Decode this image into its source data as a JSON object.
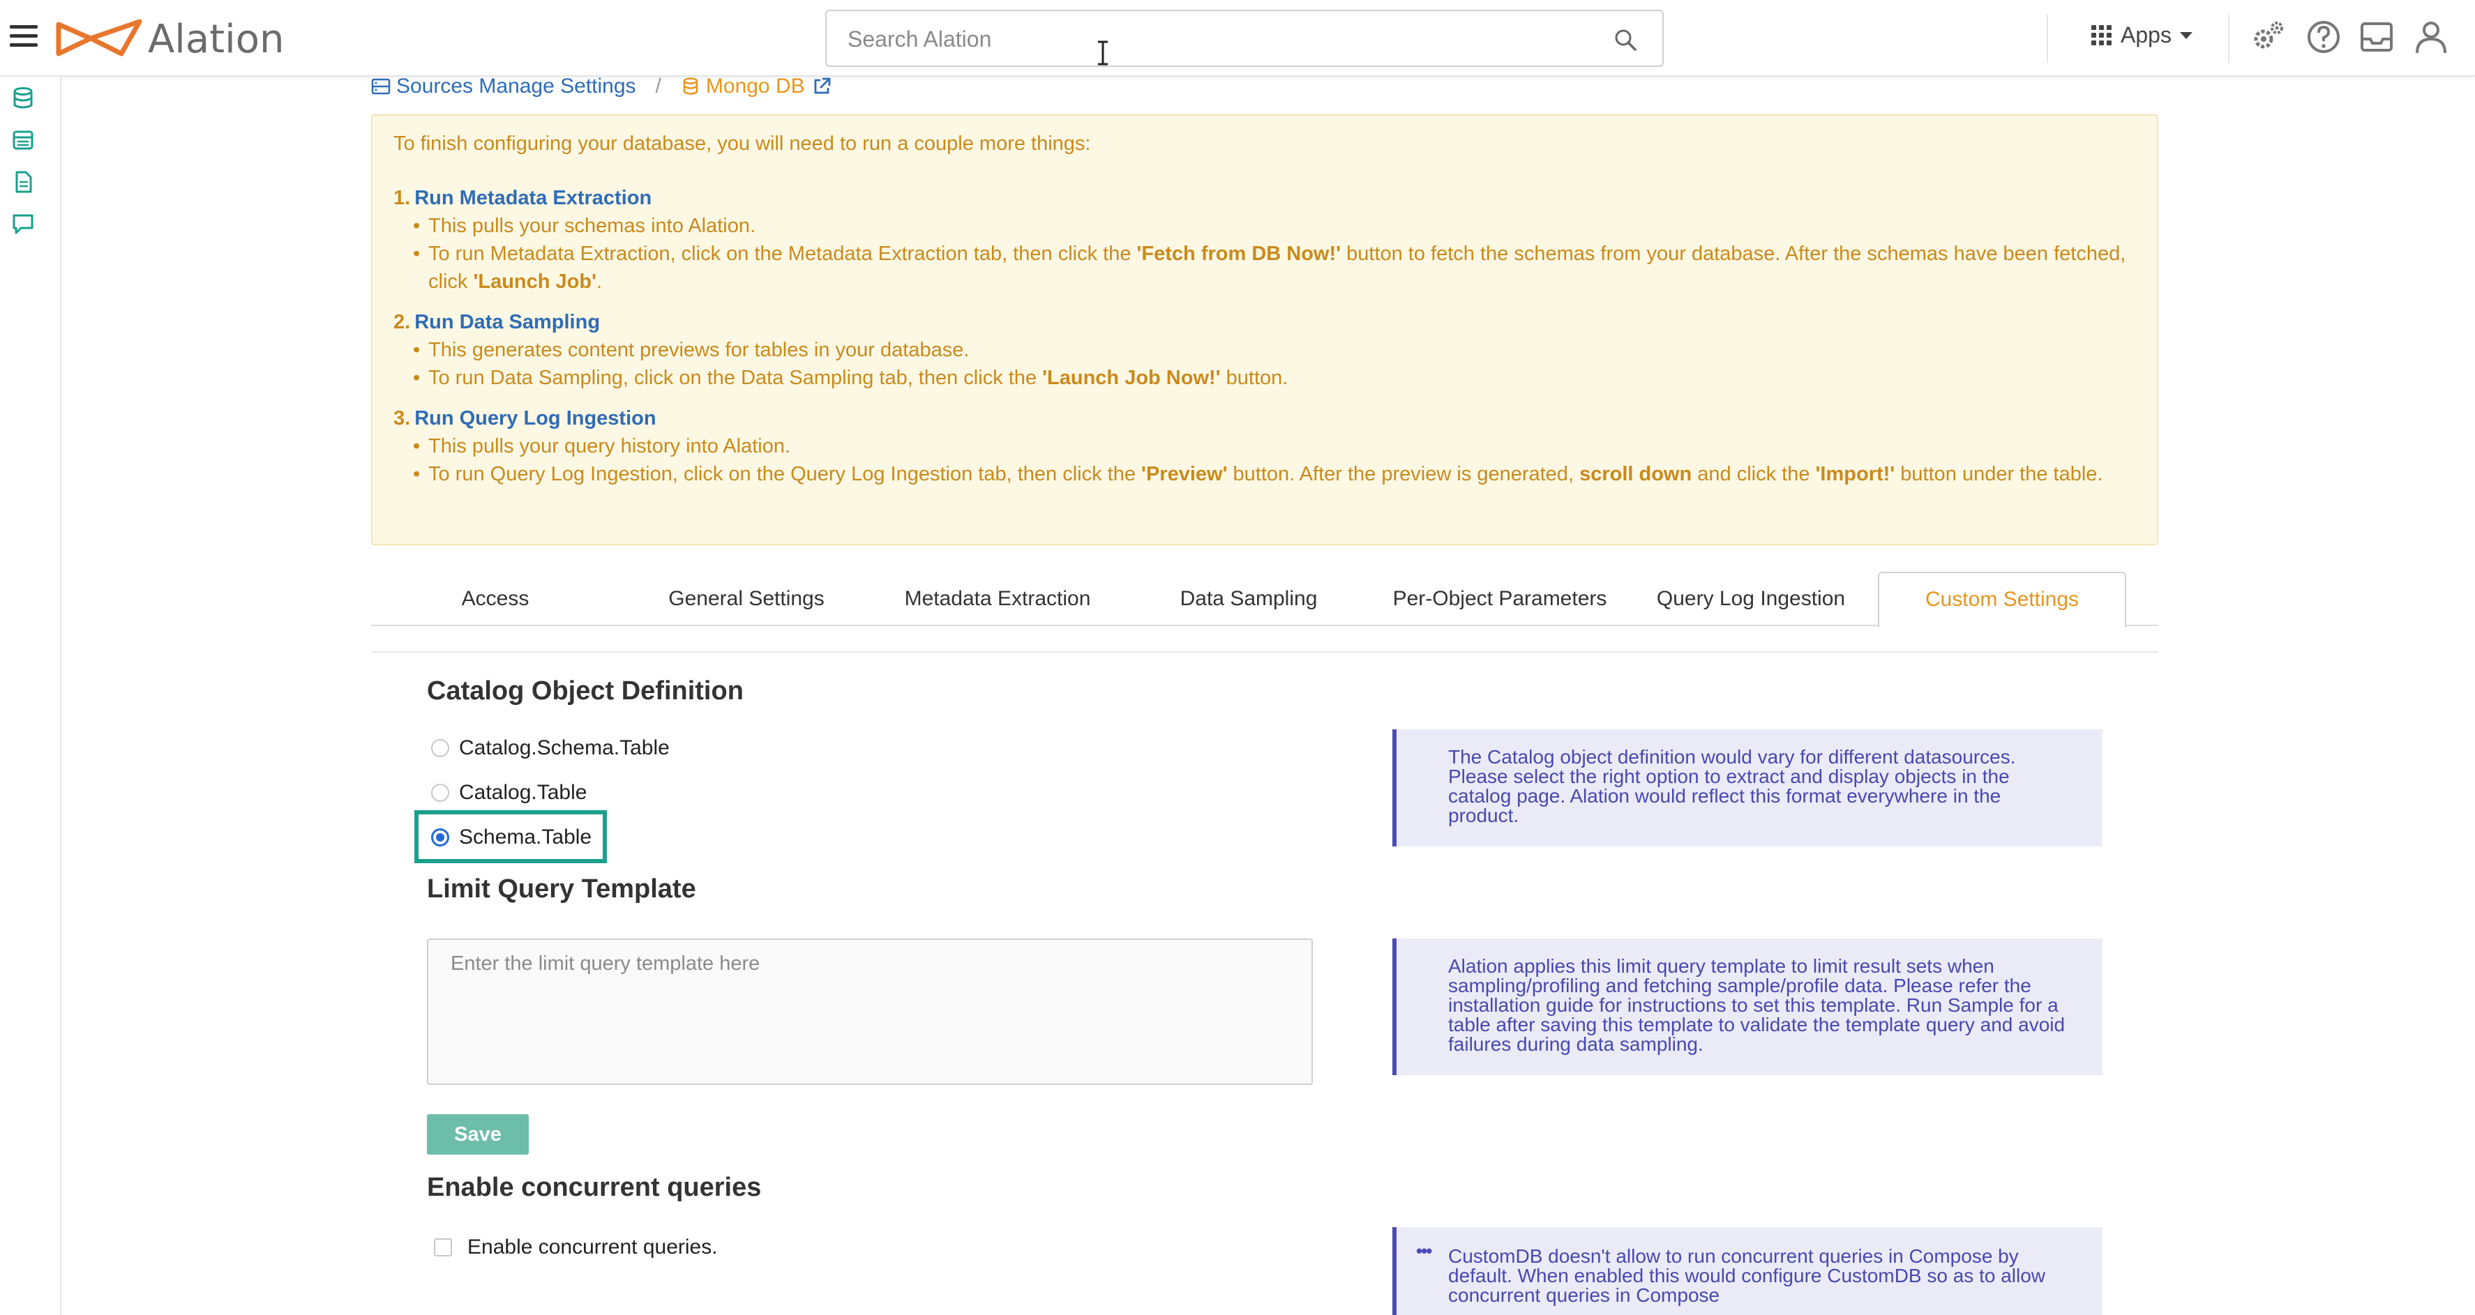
{
  "topbar": {
    "logo_text": "Alation",
    "search_placeholder": "Search Alation",
    "apps_label": "Apps"
  },
  "breadcrumb": {
    "sources": "Sources Manage Settings",
    "separator": "/",
    "database": "Mongo DB"
  },
  "info": {
    "intro": "To finish configuring your database, you will need to run a couple more things:",
    "steps": [
      {
        "num": "1.",
        "title": "Run Metadata Extraction",
        "b1": "This pulls your schemas into Alation.",
        "b2_pre": "To run Metadata Extraction, click on the Metadata Extraction tab, then click the ",
        "b2_bold1": "'Fetch from DB Now!'",
        "b2_mid": " button to fetch the schemas from your database. After the schemas have been fetched, click ",
        "b2_bold2": "'Launch Job'",
        "b2_post": "."
      },
      {
        "num": "2.",
        "title": "Run Data Sampling",
        "b1": "This generates content previews for tables in your database.",
        "b2_pre": "To run Data Sampling, click on the Data Sampling tab, then click the ",
        "b2_bold1": "'Launch Job Now!'",
        "b2_post": " button."
      },
      {
        "num": "3.",
        "title": "Run Query Log Ingestion",
        "b1": "This pulls your query history into Alation.",
        "b2_pre": "To run Query Log Ingestion, click on the Query Log Ingestion tab, then click the ",
        "b2_bold1": "'Preview'",
        "b2_mid": " button. After the preview is generated, ",
        "b2_bold2": "scroll down",
        "b2_mid2": " and click the ",
        "b2_bold3": "'Import!'",
        "b2_post": " button under the table."
      }
    ]
  },
  "tabs": [
    "Access",
    "General Settings",
    "Metadata Extraction",
    "Data Sampling",
    "Per-Object Parameters",
    "Query Log Ingestion",
    "Custom Settings"
  ],
  "active_tab": "Custom Settings",
  "catalog": {
    "heading": "Catalog Object Definition",
    "options": [
      "Catalog.Schema.Table",
      "Catalog.Table",
      "Schema.Table"
    ],
    "selected": "Schema.Table",
    "note": "The Catalog object definition would vary for different datasources. Please select the right option to extract and display objects in the catalog page. Alation would reflect this format everywhere in the product."
  },
  "limit_query": {
    "heading": "Limit Query Template",
    "placeholder": "Enter the limit query template here",
    "value": "",
    "save_label": "Save",
    "note": "Alation applies this limit query template to limit result sets when sampling/profiling and fetching sample/profile data. Please refer the installation guide for instructions to set this template. Run Sample for a table after saving this template to validate the template query and avoid failures during data sampling."
  },
  "concurrent": {
    "heading": "Enable concurrent queries",
    "checkbox_label": "Enable concurrent queries.",
    "checked": false,
    "note": "CustomDB doesn't allow to run concurrent queries in Compose by default. When enabled this would configure CustomDB so as to allow concurrent queries in Compose"
  },
  "colors": {
    "accent_orange": "#e6961e",
    "link_blue": "#2f6cb5",
    "info_bg": "#fdf8e4",
    "note_bg": "#ebebf8",
    "note_text": "#4848b0",
    "save_green": "#6dbdab",
    "highlight_teal": "#1aa08c",
    "radio_blue": "#2169d6"
  },
  "icons": {
    "menu": "hamburger-icon",
    "search": "search-icon",
    "apps": "grid-icon",
    "settings": "gears-icon",
    "help": "question-icon",
    "inbox": "inbox-icon",
    "user": "user-icon",
    "database": "database-icon",
    "external": "external-link-icon"
  }
}
